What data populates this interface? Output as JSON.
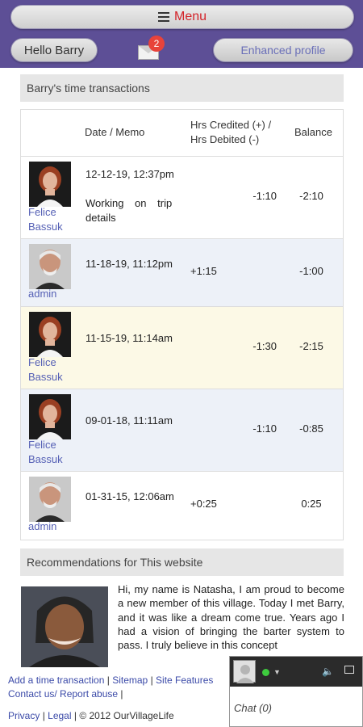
{
  "header": {
    "menu_label": "Menu",
    "hello_label": "Hello Barry",
    "messages_count": "2",
    "enhanced_label": "Enhanced profile"
  },
  "transactions": {
    "title": "Barry's time transactions",
    "columns": {
      "date": "Date / Memo",
      "hours": "Hrs Credited (+) / Hrs Debited (-)",
      "balance": "Balance"
    },
    "rows": [
      {
        "user": "Felice Bassuk",
        "date": "12-12-19, 12:37pm",
        "memo": "Working on trip details",
        "credited": "",
        "debited": "-1:10",
        "balance": "-2:10"
      },
      {
        "user": "admin",
        "date": "11-18-19, 11:12pm",
        "memo": "",
        "credited": "+1:15",
        "debited": "",
        "balance": "-1:00"
      },
      {
        "user": "Felice Bassuk",
        "date": "11-15-19, 11:14am",
        "memo": "",
        "credited": "",
        "debited": "-1:30",
        "balance": "-2:15"
      },
      {
        "user": "Felice Bassuk",
        "date": "09-01-18, 11:11am",
        "memo": "",
        "credited": "",
        "debited": "-1:10",
        "balance": "-0:85"
      },
      {
        "user": "admin",
        "date": "01-31-15, 12:06am",
        "memo": "",
        "credited": "+0:25",
        "debited": "",
        "balance": "0:25"
      }
    ]
  },
  "recommendations": {
    "title": "Recommendations for This website",
    "text": "Hi, my name is Natasha, I am proud to become a new member of this village. Today I met Barry, and it was like a dream come true. Years ago I had a vision of bringing the barter system to pass. I truly believe in this concept"
  },
  "footer": {
    "add_transaction": "Add a time transaction",
    "sitemap": "Sitemap",
    "site_features": "Site Features",
    "contact": "Contact us/ Report abuse",
    "privacy": "Privacy",
    "legal": "Legal",
    "copyright": "© 2012 OurVillageLife"
  },
  "chat": {
    "label": "Chat (0)"
  },
  "colors": {
    "header_bg": "#5d4f96",
    "menu_text": "#d4242a",
    "link": "#3b4aa8",
    "username": "#5560b5",
    "highlight_row": "#fcf9e6",
    "alt_row": "#edf1f8"
  }
}
